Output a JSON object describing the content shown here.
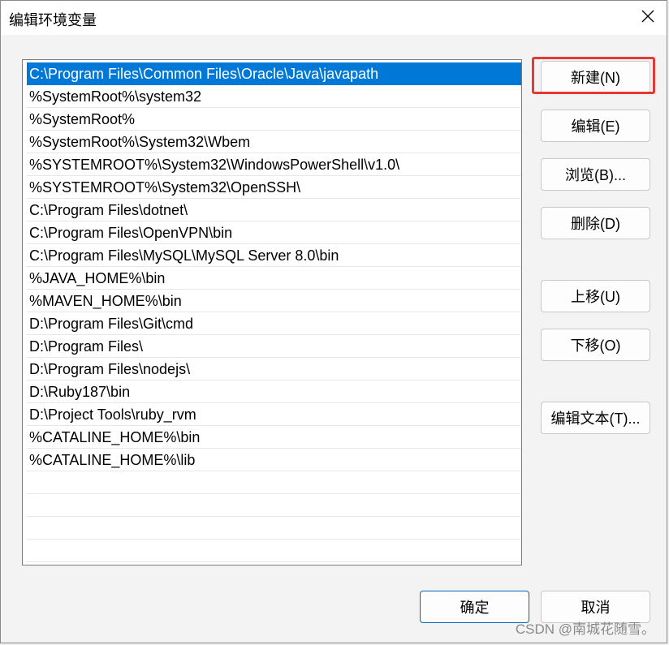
{
  "window": {
    "title": "编辑环境变量"
  },
  "paths": [
    "C:\\Program Files\\Common Files\\Oracle\\Java\\javapath",
    "%SystemRoot%\\system32",
    "%SystemRoot%",
    "%SystemRoot%\\System32\\Wbem",
    "%SYSTEMROOT%\\System32\\WindowsPowerShell\\v1.0\\",
    "%SYSTEMROOT%\\System32\\OpenSSH\\",
    "C:\\Program Files\\dotnet\\",
    "C:\\Program Files\\OpenVPN\\bin",
    "C:\\Program Files\\MySQL\\MySQL Server 8.0\\bin",
    "%JAVA_HOME%\\bin",
    "%MAVEN_HOME%\\bin",
    "D:\\Program Files\\Git\\cmd",
    "D:\\Program Files\\",
    "D:\\Program Files\\nodejs\\",
    "D:\\Ruby187\\bin",
    "D:\\Project Tools\\ruby_rvm",
    "%CATALINE_HOME%\\bin",
    "%CATALINE_HOME%\\lib",
    "",
    "",
    "",
    ""
  ],
  "selected_index": 0,
  "buttons": {
    "new": "新建(N)",
    "edit": "编辑(E)",
    "browse": "浏览(B)...",
    "delete": "删除(D)",
    "move_up": "上移(U)",
    "move_down": "下移(O)",
    "edit_text": "编辑文本(T)...",
    "ok": "确定",
    "cancel": "取消"
  },
  "watermark": "CSDN @南城花随雪。",
  "colors": {
    "selection": "#0078d7",
    "highlight": "#e53935"
  }
}
